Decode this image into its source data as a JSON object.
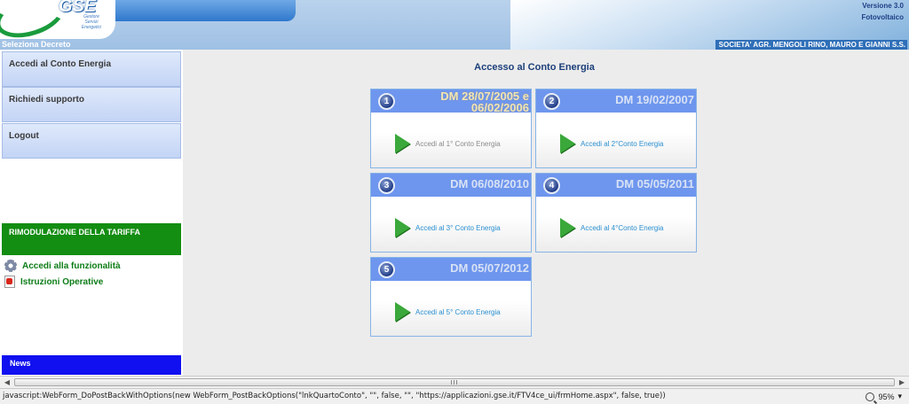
{
  "header": {
    "logo_text": "GSE",
    "logo_sub": "Gestore Servizi Energetici",
    "version": "Versione 3.0",
    "product": "Fotovoltaico",
    "seleziona": "Seleziona Decreto",
    "company": "SOCIETA' AGR. MENGOLI RINO, MAURO E GIANNI S.S."
  },
  "nav": {
    "items": [
      {
        "label": "Accedi al Conto Energia"
      },
      {
        "label": "Richiedi supporto"
      },
      {
        "label": "Logout"
      }
    ],
    "rimodulazione": {
      "title": "RIMODULAZIONE DELLA TARIFFA",
      "links": [
        {
          "label": "Accedi alla funzionalità",
          "icon": "gear-icon"
        },
        {
          "label": "Istruzioni Operative",
          "icon": "pdf-icon"
        }
      ]
    },
    "news": "News"
  },
  "main": {
    "title": "Accesso al Conto Energia",
    "cards": [
      {
        "num": "1",
        "dm": "DM 28/07/2005 e",
        "dm2": "06/02/2006",
        "link": "Accedi al 1° Conto Energia"
      },
      {
        "num": "2",
        "dm": "DM 19/02/2007",
        "link": "Accedi al 2°Conto Energia"
      },
      {
        "num": "3",
        "dm": "DM 06/08/2010",
        "link": "Accedi al 3° Conto Energia"
      },
      {
        "num": "4",
        "dm": "DM 05/05/2011",
        "link": "Accedi al 4°Conto Energia"
      },
      {
        "num": "5",
        "dm": "DM 05/07/2012",
        "link": "Accedi al 5° Conto Energia"
      }
    ]
  },
  "status": {
    "text": "javascript:WebForm_DoPostBackWithOptions(new WebForm_PostBackOptions(\"lnkQuartoConto\", \"\", false, \"\", \"https://applicazioni.gse.it/FTV4ce_ui/frmHome.aspx\", false, true))",
    "zoom": "95%"
  },
  "colors": {
    "nav_bg": "#c3d4f5",
    "rimod_green": "#138d12",
    "news_blue": "#1010f0",
    "card_head": "#6e96ee",
    "link_blue": "#2a8fd0"
  }
}
